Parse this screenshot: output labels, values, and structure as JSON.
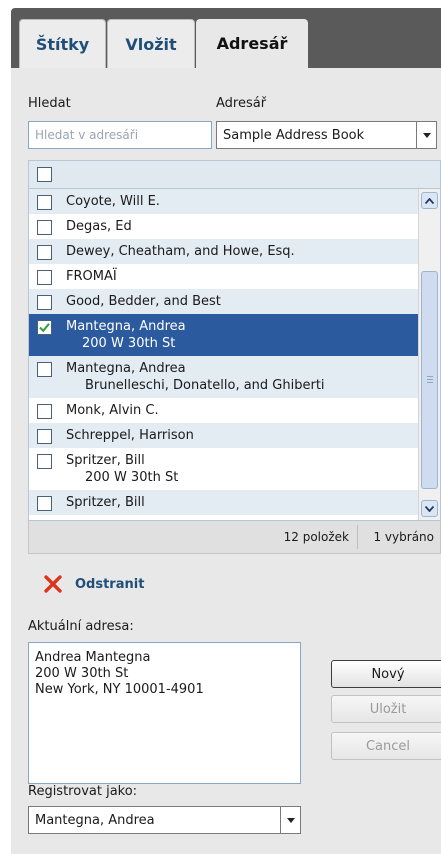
{
  "tabs": [
    {
      "label": "Štítky",
      "active": false
    },
    {
      "label": "Vložit",
      "active": false
    },
    {
      "label": "Adresář",
      "active": true
    }
  ],
  "search": {
    "label": "Hledat",
    "placeholder": "Hledat v adresáři",
    "value": ""
  },
  "address_book": {
    "label": "Adresář",
    "selected": "Sample Address Book"
  },
  "list": {
    "rows": [
      {
        "line1": "Coyote, Will E.",
        "line2": "",
        "checked": false
      },
      {
        "line1": "Degas, Ed",
        "line2": "",
        "checked": false
      },
      {
        "line1": "Dewey, Cheatham, and Howe, Esq.",
        "line2": "",
        "checked": false
      },
      {
        "line1": "FROMAÏ",
        "line2": "",
        "checked": false
      },
      {
        "line1": "Good, Bedder, and Best",
        "line2": "",
        "checked": false
      },
      {
        "line1": "Mantegna, Andrea",
        "line2": "200 W 30th St",
        "checked": true
      },
      {
        "line1": "Mantegna, Andrea",
        "line2": "Brunelleschi, Donatello, and Ghiberti",
        "checked": false
      },
      {
        "line1": "Monk, Alvin C.",
        "line2": "",
        "checked": false
      },
      {
        "line1": "Schreppel, Harrison",
        "line2": "",
        "checked": false
      },
      {
        "line1": "Spritzer, Bill",
        "line2": "200 W 30th St",
        "checked": false
      },
      {
        "line1": "Spritzer, Bill",
        "line2": "",
        "checked": false
      }
    ],
    "count_label": "12 položek",
    "selected_label": "1 vybráno"
  },
  "remove": {
    "label": "Odstranit",
    "icon": "x-icon",
    "color": "#d9361b"
  },
  "current_address": {
    "label": "Aktuální adresa:",
    "lines": [
      "Andrea Mantegna",
      "200 W 30th St",
      "New York, NY 10001-4901"
    ]
  },
  "buttons": {
    "new": "Nový",
    "save": "Uložit",
    "cancel": "Cancel"
  },
  "register": {
    "label": "Registrovat jako:",
    "selected": "Mantegna, Andrea"
  },
  "colors": {
    "accent": "#1f4e79",
    "selection": "#2b5a9e",
    "check": "#2e9e3a"
  }
}
